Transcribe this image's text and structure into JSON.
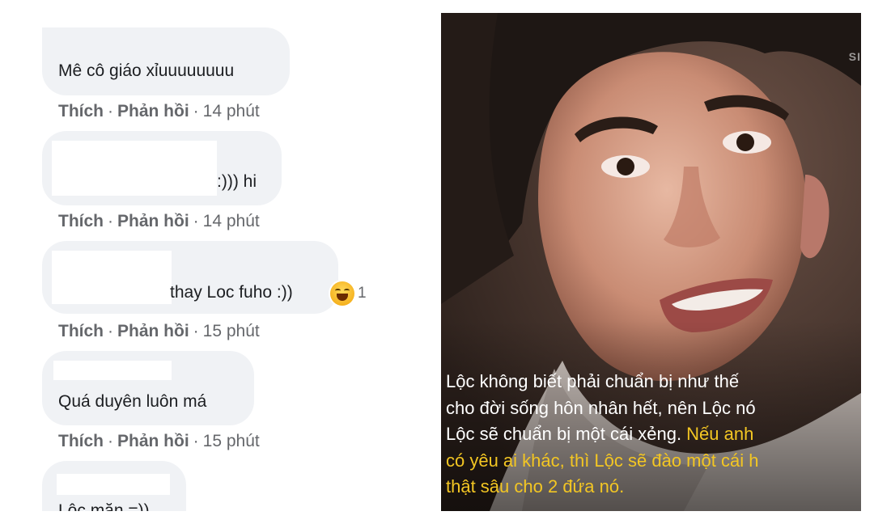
{
  "comments": [
    {
      "text": "Mê cô giáo xỉuuuuuuuu",
      "like": "Thích",
      "reply": "Phản hồi",
      "time": "14 phút"
    },
    {
      "text": ":))) hi",
      "like": "Thích",
      "reply": "Phản hồi",
      "time": "14 phút"
    },
    {
      "text": "thay Loc fuho :))",
      "like": "Thích",
      "reply": "Phản hồi",
      "time": "15 phút",
      "reaction": {
        "icon": "haha-icon",
        "count": "1"
      }
    },
    {
      "text": "Quá duyên luôn má",
      "like": "Thích",
      "reply": "Phản hồi",
      "time": "15 phút"
    },
    {
      "text": "Lộc mặn =))"
    }
  ],
  "separator": "·",
  "video": {
    "watermark": "SI",
    "caption_lines": [
      {
        "white": "Lộc không biết phải chuẩn bị như thế",
        "yellow": ""
      },
      {
        "white": "cho đời sống hôn nhân hết, nên Lộc nó",
        "yellow": ""
      },
      {
        "white": "Lộc sẽ chuẩn bị một cái xẻng. ",
        "yellow": "Nếu anh"
      },
      {
        "white": "",
        "yellow": "có yêu ai khác, thì Lộc sẽ đào một cái h"
      },
      {
        "white": "",
        "yellow": "thật sâu cho 2 đứa nó."
      }
    ],
    "colors": {
      "caption_white": "#ffffff",
      "caption_yellow": "#f3c623"
    }
  },
  "colors": {
    "bubble": "#f0f2f5",
    "meta": "#65676b",
    "text": "#1c1e21"
  }
}
